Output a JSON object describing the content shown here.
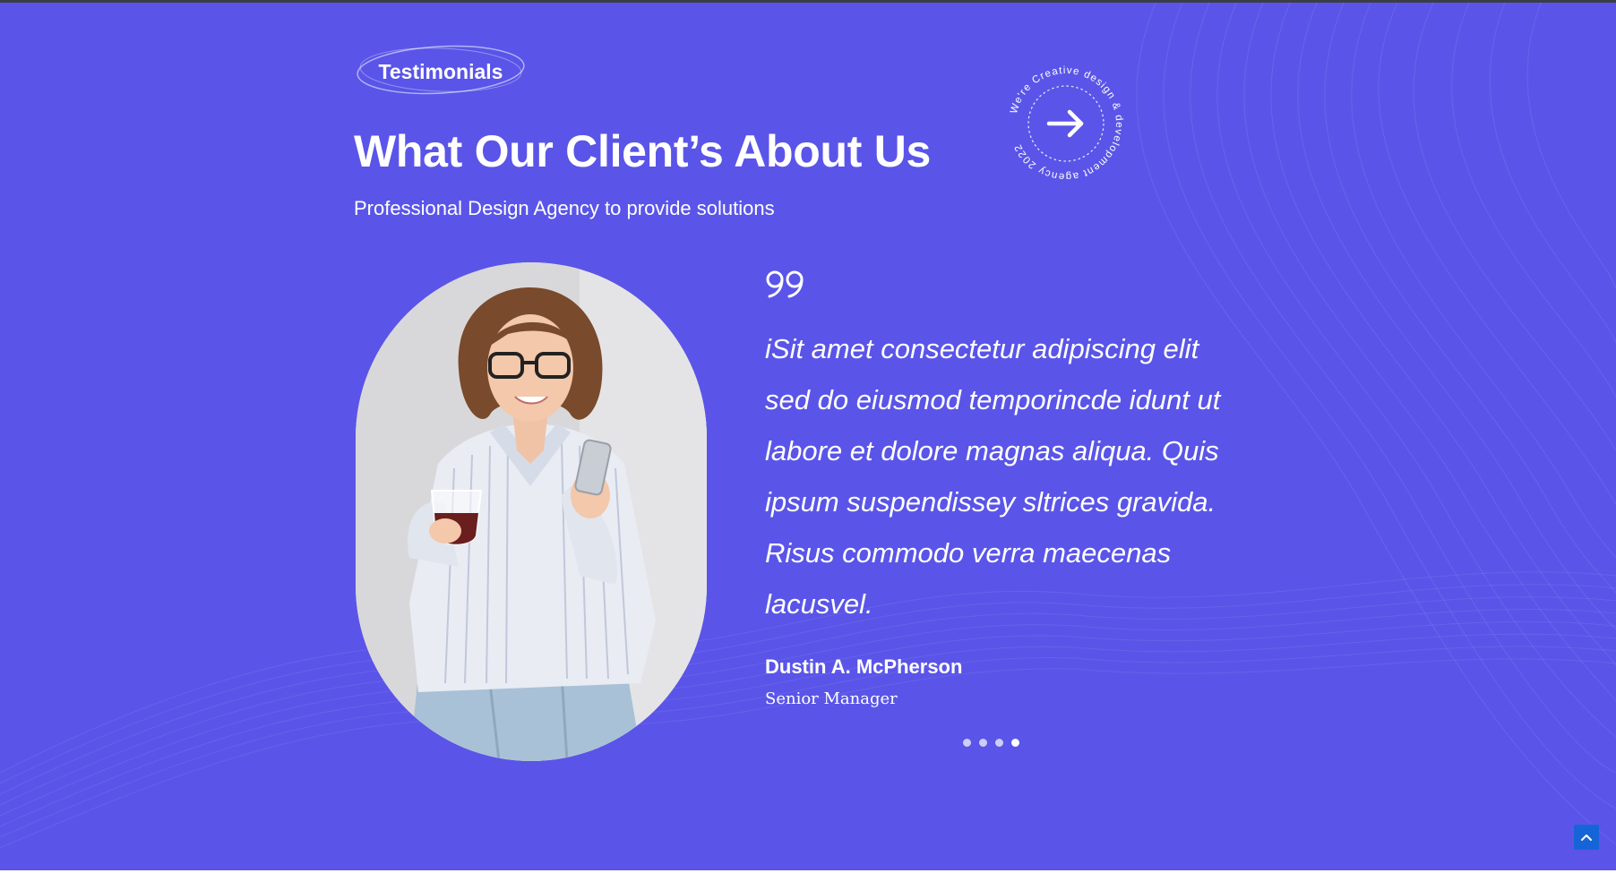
{
  "section": {
    "badge_label": "Testimonials",
    "title": "What Our Client’s About Us",
    "subtitle": "Professional Design Agency to provide solutions"
  },
  "circle_badge": {
    "ring_text": "We're Creative design & development agency 2022",
    "icon": "arrow-right-icon"
  },
  "testimonial": {
    "quote_icon": "quote-icon",
    "text": "iSit amet consectetur adipiscing elit sed do eiusmod temporincde idunt ut labore et dolore magnas aliqua. Quis ipsum suspendissey sltrices gravida. Risus commodo verra maecenas lacusvel.",
    "author": "Dustin A. McPherson",
    "role": "Senior Manager"
  },
  "slider": {
    "dot_count": 4,
    "active_index": 3
  },
  "scroll_top": {
    "icon": "chevron-up-icon"
  },
  "colors": {
    "background": "#5a55e8",
    "text": "#ffffff",
    "scroll_button": "#1665d8"
  }
}
